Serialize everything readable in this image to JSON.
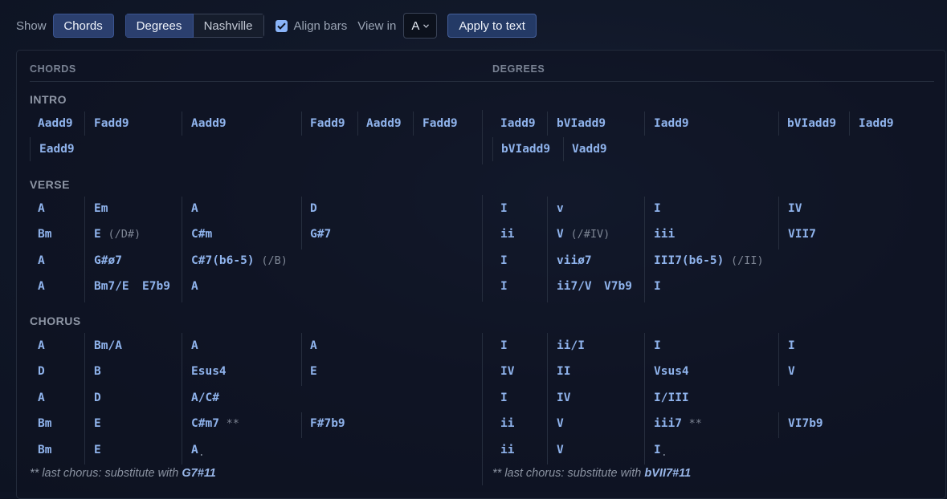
{
  "toolbar": {
    "show_label": "Show",
    "chords_label": "Chords",
    "degrees_label": "Degrees",
    "nashville_label": "Nashville",
    "align_bars_label": "Align bars",
    "align_bars_checked": true,
    "view_in_label": "View in",
    "view_in_value": "A",
    "apply_label": "Apply to text",
    "accent_color": "#8ab4f8"
  },
  "columns": {
    "chords": "CHORDS",
    "degrees": "DEGREES"
  },
  "sections": [
    {
      "name": "INTRO",
      "chords": [
        [
          "Aadd9",
          "Fadd9",
          "Aadd9",
          "Fadd9",
          "Aadd9",
          "Fadd9"
        ],
        [
          "Eadd9"
        ]
      ],
      "degrees": [
        [
          "Iadd9",
          "bVIadd9",
          "Iadd9",
          "bVIadd9",
          "Iadd9"
        ],
        [
          "bVIadd9",
          "Vadd9"
        ]
      ]
    },
    {
      "name": "VERSE",
      "chords": [
        [
          "A",
          "Em",
          "A",
          "D"
        ],
        [
          "Bm",
          "E",
          "C#m",
          "G#7"
        ],
        [
          "A",
          "G#ø7",
          "C#7(b6-5)"
        ],
        [
          "A",
          "Bm7/E",
          "E7b9",
          "A"
        ]
      ],
      "chords_annotations": [
        "(/D#)",
        "(/B)"
      ],
      "degrees": [
        [
          "I",
          "v",
          "I",
          "IV"
        ],
        [
          "ii",
          "V",
          "iii",
          "VII7"
        ],
        [
          "I",
          "viiø7",
          "III7(b6-5)"
        ],
        [
          "I",
          "ii7/V",
          "V7b9",
          "I"
        ]
      ],
      "degrees_annotations": [
        "(/#IV)",
        "(/II)"
      ]
    },
    {
      "name": "CHORUS",
      "chords": [
        [
          "A",
          "Bm/A",
          "A",
          "A"
        ],
        [
          "D",
          "B",
          "Esus4",
          "E"
        ],
        [
          "A",
          "D",
          "A/C#"
        ],
        [
          "Bm",
          "E",
          "C#m7",
          "F#7b9"
        ],
        [
          "Bm",
          "E",
          "A"
        ]
      ],
      "degrees": [
        [
          "I",
          "ii/I",
          "I",
          "I"
        ],
        [
          "IV",
          "II",
          "Vsus4",
          "V"
        ],
        [
          "I",
          "IV",
          "I/III"
        ],
        [
          "ii",
          "V",
          "iii7",
          "VI7b9"
        ],
        [
          "ii",
          "V",
          "I"
        ]
      ],
      "marks": {
        "double_star": "**",
        "dot": "."
      },
      "chords_note": {
        "text": "** last chorus: substitute with ",
        "chord": "G7#11"
      },
      "degrees_note": {
        "text": "** last chorus: substitute with ",
        "chord": "bVII7#11"
      }
    }
  ]
}
